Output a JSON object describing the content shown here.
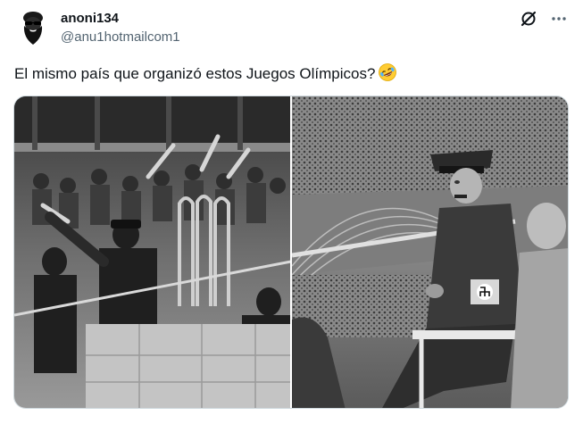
{
  "author": {
    "display_name": "anoni134",
    "handle": "@anu1hotmailcom1",
    "avatar_icon": "bearded-man-sunglasses-avatar"
  },
  "actions": {
    "grok_icon": "grok-slash-circle-icon",
    "more_icon": "more-dots-icon"
  },
  "tweet": {
    "text": "El mismo país que organizó estos Juegos Olímpicos?",
    "emoji": "rolling-on-floor-laughing-emoji"
  },
  "media": {
    "count": 2,
    "photos": [
      {
        "style": "black-and-white",
        "subject": "crowd saluting in stadium stands"
      },
      {
        "style": "black-and-white",
        "subject": "officer seated at stadium railing overlooking track"
      }
    ]
  },
  "colors": {
    "text_primary": "#0f1419",
    "text_secondary": "#536471",
    "border": "#cfd9de",
    "background": "#ffffff"
  }
}
